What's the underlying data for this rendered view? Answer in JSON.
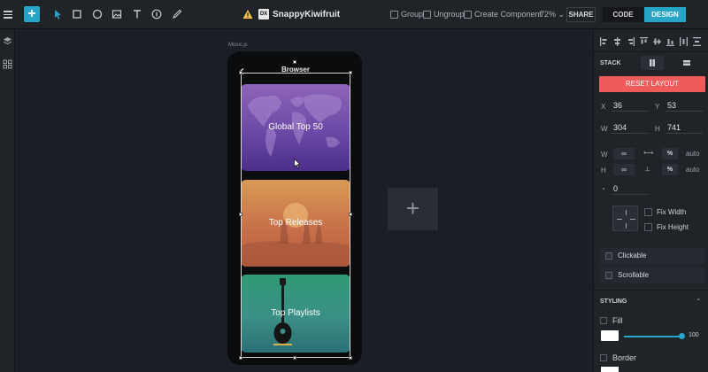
{
  "toolbar": {
    "project_name": "SnappyKiwifruit",
    "dx_badge": "DX",
    "group_label": "Group",
    "ungroup_label": "Ungroup",
    "create_component_label": "Create Component",
    "zoom": "72%",
    "share_label": "SHARE",
    "code_label": "CODE",
    "design_label": "DESIGN",
    "accent_color": "#27a5c6"
  },
  "canvas": {
    "artboard_label": "Music.js",
    "add_artboard_symbol": "+",
    "phone": {
      "title": "Browser",
      "cards": [
        {
          "label": "Global Top 50"
        },
        {
          "label": "Top Releases"
        },
        {
          "label": "Top Playlists"
        }
      ]
    }
  },
  "panel": {
    "stack_label": "STACK",
    "reset_layout_label": "RESET LAYOUT",
    "reset_color": "#ef5a5a",
    "x_label": "X",
    "x_value": "36",
    "y_label": "Y",
    "y_value": "53",
    "w_label": "W",
    "w_value": "304",
    "h_label": "H",
    "h_value": "741",
    "w2_label": "W",
    "w_infinity": "∞",
    "w_percent": "%",
    "w_auto": "auto",
    "h2_label": "H",
    "h_infinity": "∞",
    "h_percent": "%",
    "h_auto": "auto",
    "radius_value": "0",
    "fix_width_label": "Fix Width",
    "fix_height_label": "Fix Height",
    "clickable_label": "Clickable",
    "scrollable_label": "Scrollable",
    "styling_label": "STYLING",
    "fill_label": "Fill",
    "fill_opacity": "100",
    "border_label": "Border"
  }
}
